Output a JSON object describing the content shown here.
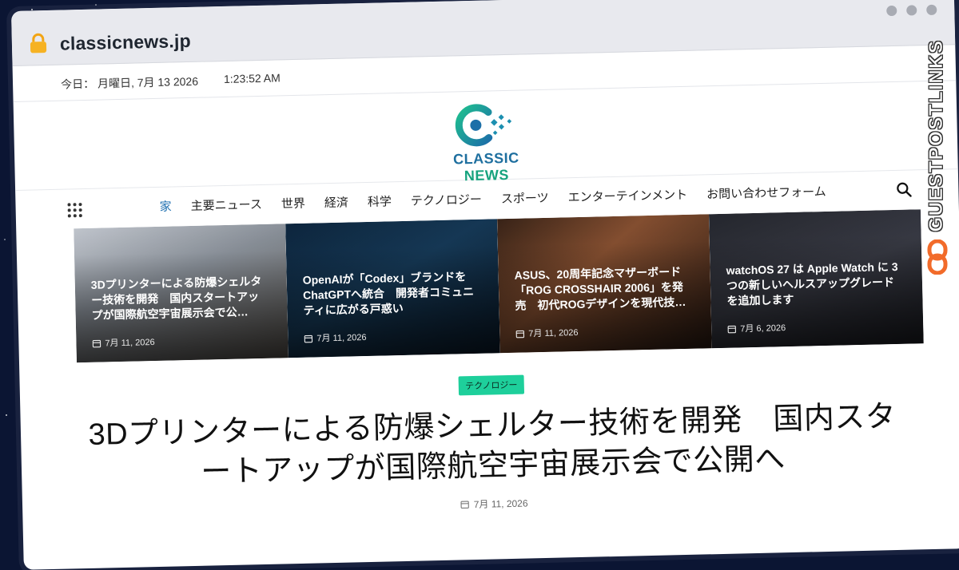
{
  "browser": {
    "url": "classicnews.jp"
  },
  "topbar": {
    "date": "今日： 月曜日, 7月 13 2026",
    "time": "1:23:52 AM"
  },
  "logo": {
    "word1": "CLASSIC",
    "word2": "NEWS"
  },
  "nav": {
    "items": [
      {
        "label": "家"
      },
      {
        "label": "主要ニュース"
      },
      {
        "label": "世界"
      },
      {
        "label": "経済"
      },
      {
        "label": "科学"
      },
      {
        "label": "テクノロジー"
      },
      {
        "label": "スポーツ"
      },
      {
        "label": "エンターテインメント"
      },
      {
        "label": "お問い合わせフォーム"
      }
    ]
  },
  "featured": [
    {
      "title": "3Dプリンターによる防爆シェルター技術を開発　国内スタートアップが国際航空宇宙展示会で公…",
      "date": "7月 11, 2026"
    },
    {
      "title": "OpenAIが「Codex」ブランドをChatGPTへ統合　開発者コミュニティに広がる戸惑い",
      "date": "7月 11, 2026"
    },
    {
      "title": "ASUS、20周年記念マザーボード「ROG CROSSHAIR 2006」を発売　初代ROGデザインを現代技…",
      "date": "7月 11, 2026"
    },
    {
      "title": "watchOS 27 は Apple Watch に 3 つの新しいヘルスアップグレードを追加します",
      "date": "7月 6, 2026"
    }
  ],
  "article": {
    "category": "テクノロジー",
    "headline": "3Dプリンターによる防爆シェルター技術を開発　国内スタートアップが国際航空宇宙展示会で公開へ",
    "date": "7月 11, 2026"
  },
  "side_brand": {
    "text": "GUESTPOSTLINKS"
  },
  "colors": {
    "accent": "#1e6fb0",
    "badge": "#1ecf9b",
    "background": "#0b1533"
  }
}
